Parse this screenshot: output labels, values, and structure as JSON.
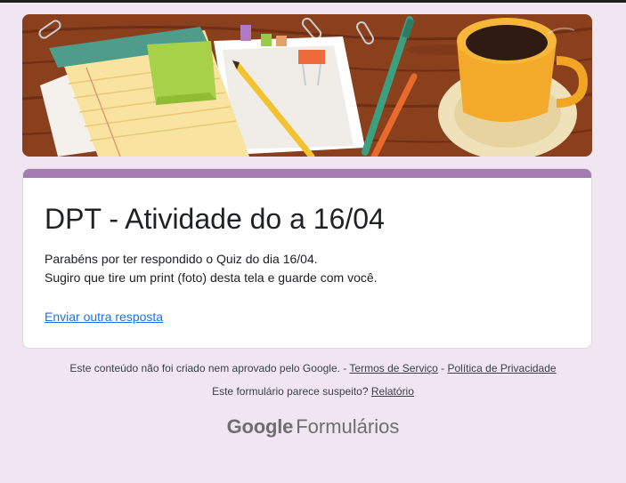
{
  "form": {
    "title": "DPT - Atividade do a 16/04",
    "message_line1": "Parabéns por ter respondido o Quiz do dia 16/04.",
    "message_line2": "Sugiro que tire um print (foto) desta tela e guarde com você.",
    "resubmit_link": "Enviar outra resposta"
  },
  "footer": {
    "disclaimer": "Este conteúdo não foi criado nem aprovado pelo Google. -",
    "separator": "-",
    "terms_link": "Termos de Serviço",
    "privacy_link": "Política de Privacidade",
    "suspicious_text": "Este formulário parece suspeito?",
    "report_link": "Relatório",
    "brand_google": "Google",
    "brand_product": "Formulários"
  },
  "header_image": {
    "icons": [
      "notepad-icon",
      "sticky-note-icon",
      "pencil-icon",
      "paper-clip-icon",
      "pen-icon",
      "coffee-cup-icon"
    ]
  },
  "colors": {
    "page_background": "#efe6f2",
    "card_accent": "#a47bb3",
    "link": "#1a73e8",
    "title_text": "#202124"
  }
}
